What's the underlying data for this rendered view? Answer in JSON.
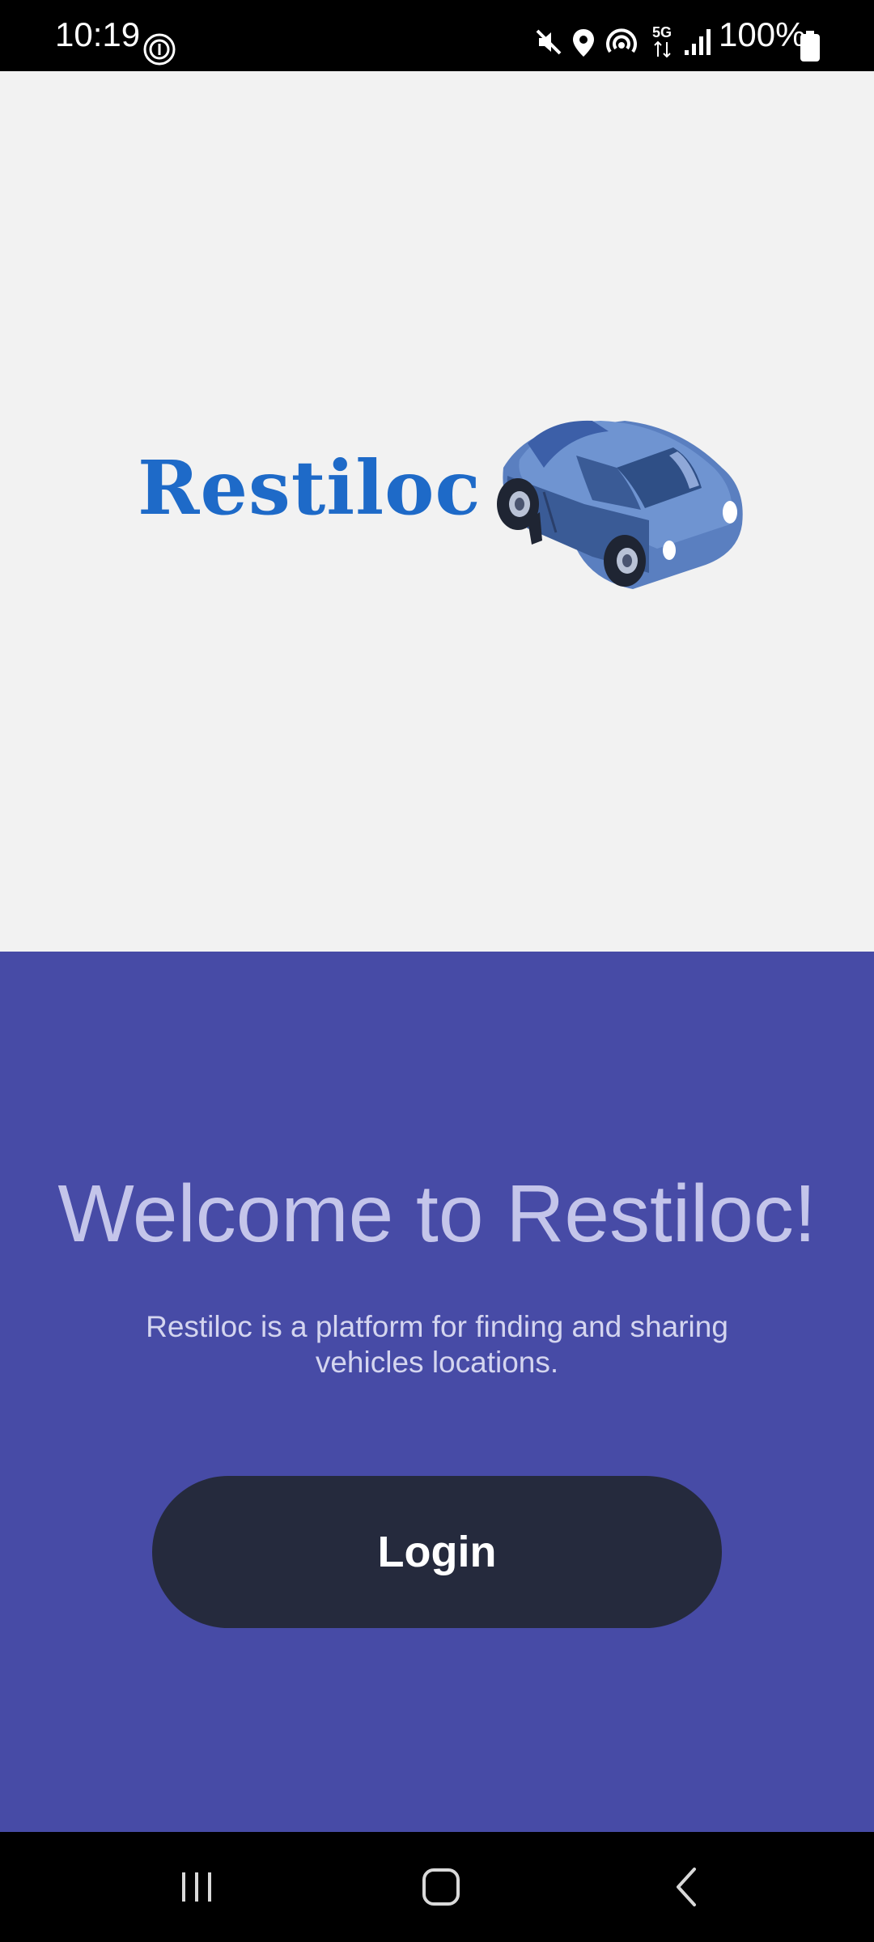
{
  "status_bar": {
    "time": "10:19",
    "battery": "100%",
    "icons": [
      "fingerprint-icon",
      "mute-icon",
      "location-icon",
      "hotspot-icon",
      "5g-icon",
      "signal-icon",
      "battery-icon"
    ]
  },
  "hero": {
    "logo_text": "Restiloc",
    "illustration": "car-icon"
  },
  "welcome": {
    "title": "Welcome to Restiloc!",
    "description": "Restiloc is a platform for finding and sharing vehicles locations.",
    "login_label": "Login"
  },
  "colors": {
    "hero_background": "#f2f2f2",
    "panel_background": "#474ba6",
    "title_color": "#c4c5ea",
    "button_background": "#252a3d",
    "logo_color": "#1e6ac8"
  },
  "nav_bar": {
    "buttons": [
      "recent-apps-icon",
      "home-icon",
      "back-icon"
    ]
  }
}
